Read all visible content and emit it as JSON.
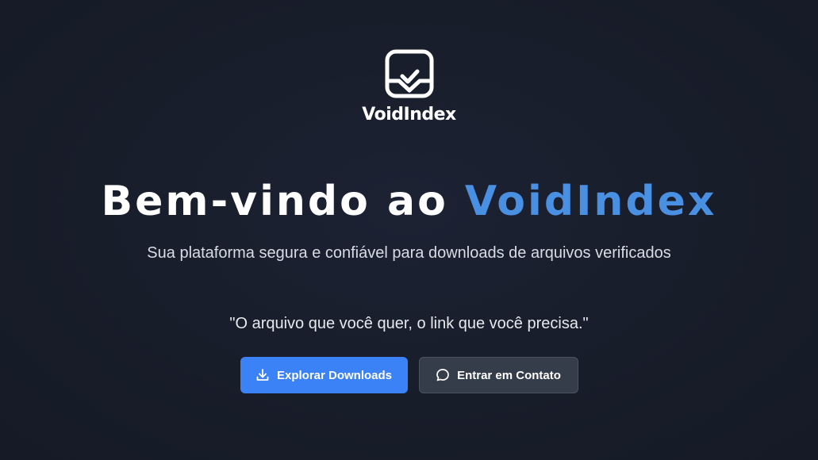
{
  "brand": {
    "name": "VoidIndex",
    "logo_icon": "message-check-icon"
  },
  "hero": {
    "headline_prefix": "Bem-vindo ao ",
    "headline_accent": "VoidIndex",
    "subtitle": "Sua plataforma segura e confiável para downloads de arquivos verificados",
    "quote": "\"O arquivo que você quer, o link que você precisa.\""
  },
  "actions": {
    "primary_label": "Explorar Downloads",
    "primary_icon": "download-icon",
    "secondary_label": "Entrar em Contato",
    "secondary_icon": "chat-bubble-icon"
  },
  "colors": {
    "background": "#181d2a",
    "accent": "#4a90e2",
    "primary_button": "#3b82f6",
    "secondary_button": "#353c4a"
  }
}
